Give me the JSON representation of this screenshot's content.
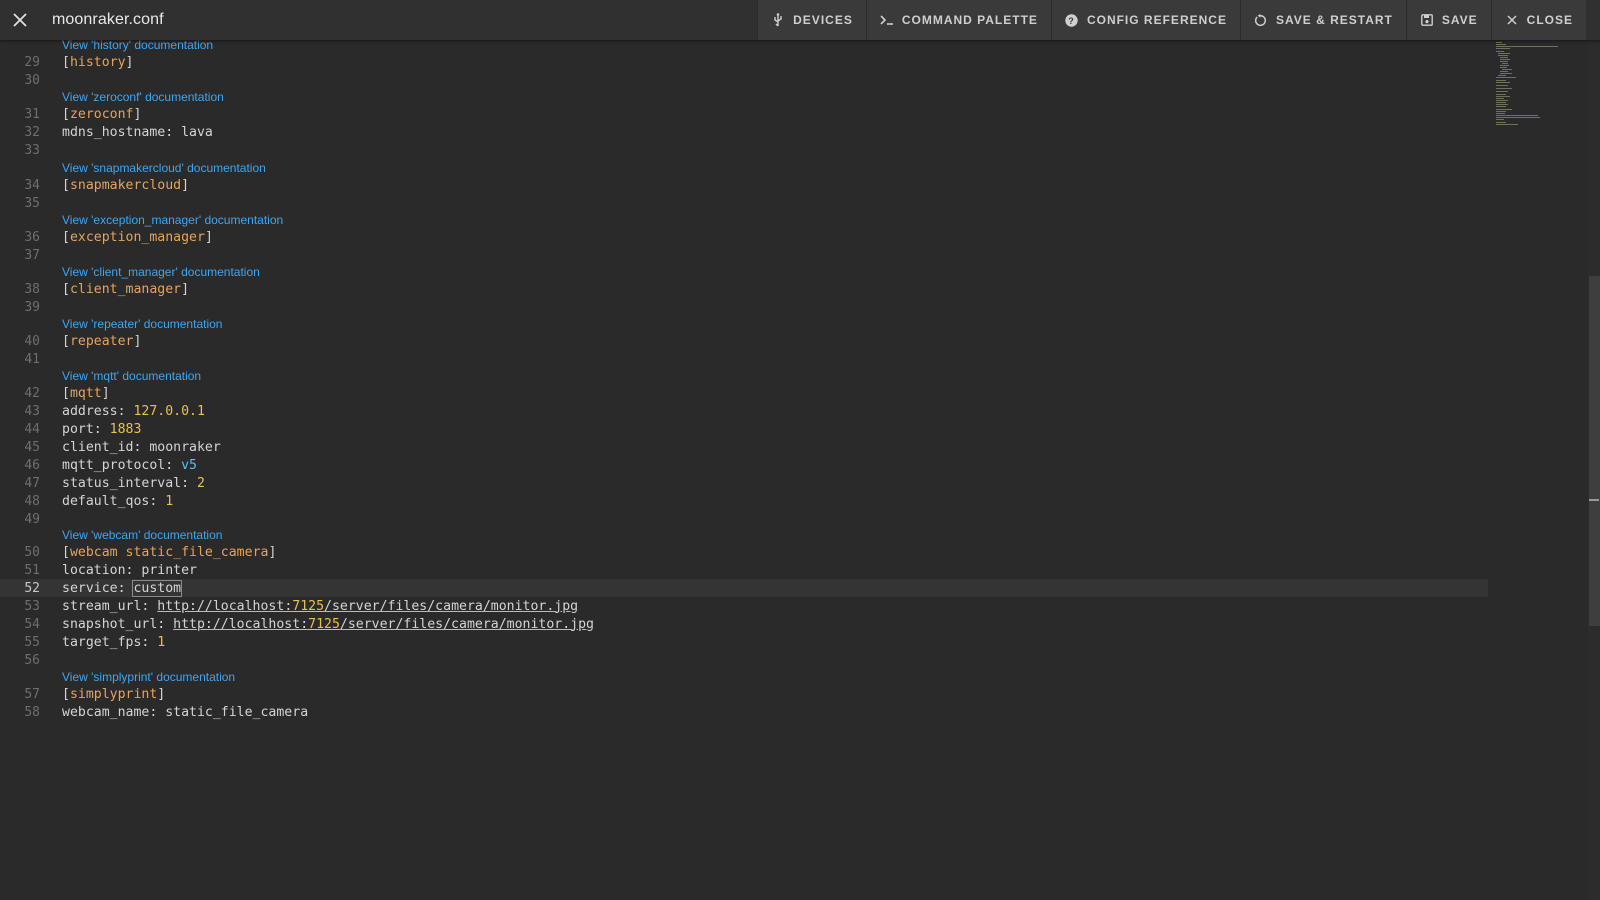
{
  "toolbar": {
    "title": "moonraker.conf",
    "close_icon": "close-icon",
    "buttons": [
      {
        "label": "Devices",
        "icon": "usb-icon"
      },
      {
        "label": "Command Palette",
        "icon": "console-icon"
      },
      {
        "label": "Config Reference",
        "icon": "help-circle-icon"
      },
      {
        "label": "Save & Restart",
        "icon": "restart-icon"
      },
      {
        "label": "Save",
        "icon": "floppy-icon"
      },
      {
        "label": "Close",
        "icon": "close-icon"
      }
    ]
  },
  "editor": {
    "current_line": 52,
    "lenses": {
      "history": "View 'history' documentation",
      "zeroconf": "View 'zeroconf' documentation",
      "snapmakercloud": "View 'snapmakercloud' documentation",
      "exception_manager": "View 'exception_manager' documentation",
      "client_manager": "View 'client_manager' documentation",
      "repeater": "View 'repeater' documentation",
      "mqtt": "View 'mqtt' documentation",
      "webcam": "View 'webcam' documentation",
      "simplyprint": "View 'simplyprint' documentation"
    },
    "lines": {
      "l29": {
        "num": "29",
        "section": "history"
      },
      "l30": {
        "num": "30"
      },
      "l31": {
        "num": "31",
        "section": "zeroconf"
      },
      "l32": {
        "num": "32",
        "key": "mdns_hostname: ",
        "value": "lava"
      },
      "l33": {
        "num": "33"
      },
      "l34": {
        "num": "34",
        "section": "snapmakercloud"
      },
      "l35": {
        "num": "35"
      },
      "l36": {
        "num": "36",
        "section": "exception_manager"
      },
      "l37": {
        "num": "37"
      },
      "l38": {
        "num": "38",
        "section": "client_manager"
      },
      "l39": {
        "num": "39"
      },
      "l40": {
        "num": "40",
        "section": "repeater"
      },
      "l41": {
        "num": "41"
      },
      "l42": {
        "num": "42",
        "section": "mqtt"
      },
      "l43": {
        "num": "43",
        "key": "address: ",
        "value": "127.0.0.1"
      },
      "l44": {
        "num": "44",
        "key": "port: ",
        "value": "1883"
      },
      "l45": {
        "num": "45",
        "key": "client_id: ",
        "value": "moonraker"
      },
      "l46": {
        "num": "46",
        "key": "mqtt_protocol: ",
        "value": "v5"
      },
      "l47": {
        "num": "47",
        "key": "status_interval: ",
        "value": "2"
      },
      "l48": {
        "num": "48",
        "key": "default_qos: ",
        "value": "1"
      },
      "l49": {
        "num": "49"
      },
      "l50": {
        "num": "50",
        "section": "webcam static_file_camera"
      },
      "l51": {
        "num": "51",
        "key": "location: ",
        "value": "printer"
      },
      "l52": {
        "num": "52",
        "key": "service: ",
        "value": "custom"
      },
      "l53": {
        "num": "53",
        "key": "stream_url: ",
        "url_a": "http://localhost:",
        "url_port": "7125",
        "url_b": "/server/files/camera/monitor.jpg"
      },
      "l54": {
        "num": "54",
        "key": "snapshot_url: ",
        "url_a": "http://localhost:",
        "url_port": "7125",
        "url_b": "/server/files/camera/monitor.jpg"
      },
      "l55": {
        "num": "55",
        "key": "target_fps: ",
        "value": "1"
      },
      "l56": {
        "num": "56"
      },
      "l57": {
        "num": "57",
        "section": "simplyprint"
      },
      "l58": {
        "num": "58",
        "key": "webcam_name: ",
        "value": "static_file_camera"
      }
    }
  },
  "colors": {
    "background": "#2a2a2b",
    "section": "#e6a35c",
    "number": "#e8c14a",
    "keyword": "#4fc1ff",
    "link": "#3ea6f2"
  }
}
